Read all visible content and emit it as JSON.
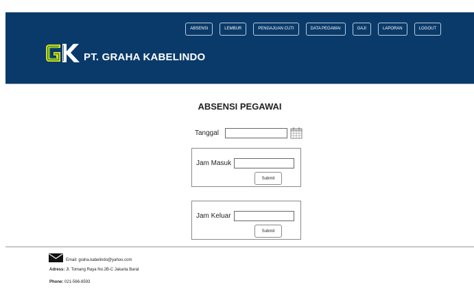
{
  "header": {
    "company_name": "PT. GRAHA KABELINDO",
    "logo_icon": "gk-logo-icon",
    "background_color": "#0a3a6a",
    "nav": [
      {
        "label": "ABSENSI"
      },
      {
        "label": "LEMBUR"
      },
      {
        "label": "PENGAJUAN CUTI"
      },
      {
        "label": "DATA PEGAWAI"
      },
      {
        "label": "GAJI"
      },
      {
        "label": "LAPORAN"
      },
      {
        "label": "LOGOUT"
      }
    ]
  },
  "main": {
    "title": "ABSENSI PEGAWAI",
    "date": {
      "label": "Tanggal",
      "value": "",
      "icon": "calendar-icon"
    },
    "check_in": {
      "label": "Jam Masuk",
      "value": "",
      "submit_label": "Submit"
    },
    "check_out": {
      "label": "Jam Keluar",
      "value": "",
      "submit_label": "Submit"
    }
  },
  "footer": {
    "email_icon": "envelope-icon",
    "email_key": "Email:",
    "email_value": "graha.kabelindo@yahoo.com",
    "address_key": "Adress:",
    "address_value": "Jl. Tomang Raya No.2B-C Jakarta Barat",
    "phone_key": "Phone:",
    "phone_value": "021-566-8593"
  }
}
